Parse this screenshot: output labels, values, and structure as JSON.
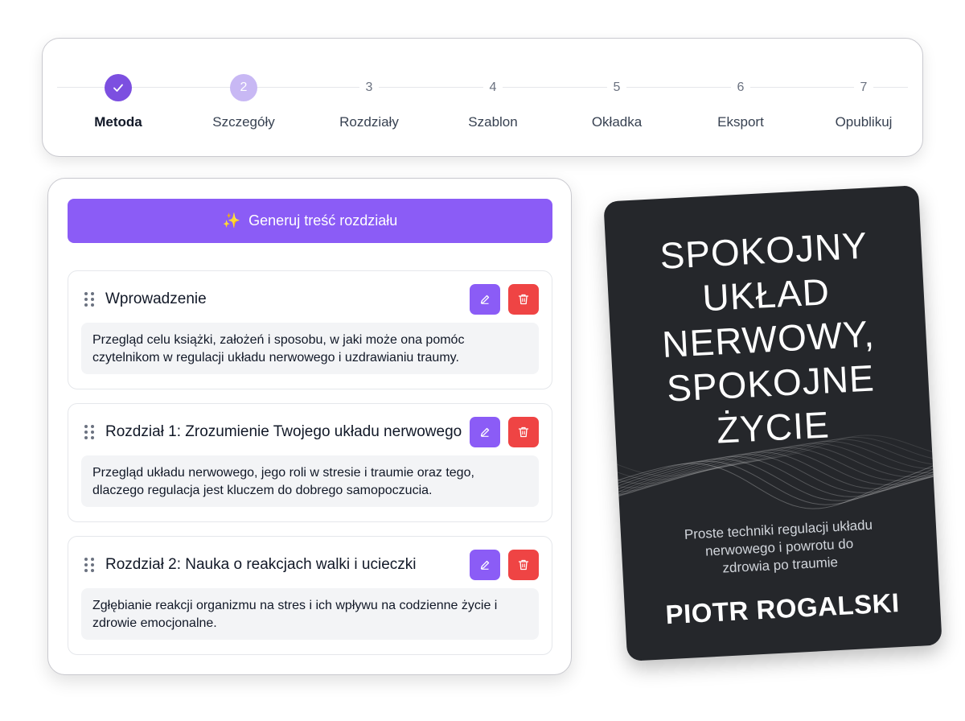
{
  "stepper": {
    "steps": [
      {
        "marker": "",
        "label": "Metoda",
        "state": "done"
      },
      {
        "marker": "2",
        "label": "Szczegóły",
        "state": "current"
      },
      {
        "marker": "3",
        "label": "Rozdziały",
        "state": "pending"
      },
      {
        "marker": "4",
        "label": "Szablon",
        "state": "pending"
      },
      {
        "marker": "5",
        "label": "Okładka",
        "state": "pending"
      },
      {
        "marker": "6",
        "label": "Eksport",
        "state": "pending"
      },
      {
        "marker": "7",
        "label": "Opublikuj",
        "state": "pending"
      }
    ]
  },
  "generate": {
    "label": "Generuj treść rozdziału",
    "icon": "sparkles-icon"
  },
  "chapters": [
    {
      "title": "Wprowadzenie",
      "description": "Przegląd celu książki, założeń i sposobu, w jaki może ona pomóc czytelnikom w regulacji układu nerwowego i uzdrawianiu traumy."
    },
    {
      "title": "Rozdział 1: Zrozumienie Twojego układu nerwowego",
      "description": "Przegląd układu nerwowego, jego roli w stresie i traumie oraz tego, dlaczego regulacja jest kluczem do dobrego samopoczucia."
    },
    {
      "title": "Rozdział 2: Nauka o reakcjach walki i ucieczki",
      "description": "Zgłębianie reakcji organizmu na stres i ich wpływu na codzienne życie i zdrowie emocjonalne."
    }
  ],
  "cover": {
    "title_lines": [
      "SPOKOJNY",
      "UKŁAD",
      "NERWOWY,",
      "SPOKOJNE",
      "ŻYCIE"
    ],
    "subtitle_lines": [
      "Proste techniki regulacji układu",
      "nerwowego i powrotu do",
      "zdrowia po traumie"
    ],
    "author": "PIOTR ROGALSKI"
  },
  "colors": {
    "accent": "#8b5cf6",
    "danger": "#ef4444",
    "cover_bg": "#25272b"
  }
}
